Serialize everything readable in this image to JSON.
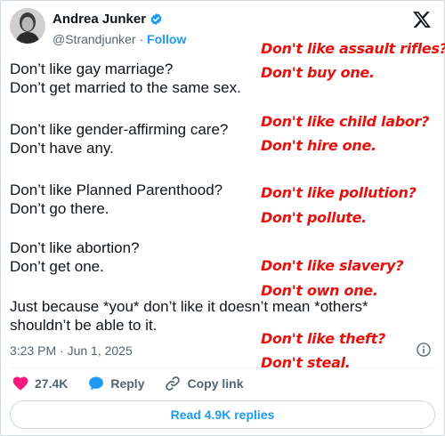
{
  "author": {
    "name": "Andrea Junker",
    "handle": "@Strandjunker",
    "separator": "·",
    "follow_label": "Follow"
  },
  "tweet": {
    "paragraphs": [
      [
        "Don’t like gay marriage?",
        "Don’t get married to the same sex."
      ],
      [
        "Don’t like gender-affirming care?",
        "Don’t have any."
      ],
      [
        "Don’t like Planned Parenthood?",
        "Don’t go there."
      ],
      [
        "Don’t like abortion?",
        "Don’t get one."
      ],
      [
        "Just because *you* don’t like it doesn’t mean *others*",
        "shouldn’t be able to it."
      ]
    ],
    "timestamp": "3:23 PM · Jun 1, 2025"
  },
  "annotations": [
    [
      "Don't like assault rifles?",
      "Don't buy one."
    ],
    [
      "Don't like child labor?",
      "Don't hire one."
    ],
    [
      "Don't like pollution?",
      "Don't pollute."
    ],
    [
      "Don't like slavery?",
      "Don't own one."
    ],
    [
      "Don't like theft?",
      "Don't steal."
    ]
  ],
  "actions": {
    "likes_count": "27.4K",
    "reply_label": "Reply",
    "copy_link_label": "Copy link"
  },
  "replies_button_label": "Read 4.9K replies",
  "icons": {
    "verified": "verified-badge-icon",
    "x_logo": "x-logo-icon",
    "info": "info-icon",
    "like": "heart-icon",
    "reply": "speech-bubble-icon",
    "link": "link-icon"
  },
  "colors": {
    "accent": "#1d9bf0",
    "heart": "#f91880",
    "annotation": "#e3130f",
    "muted": "#536471"
  }
}
